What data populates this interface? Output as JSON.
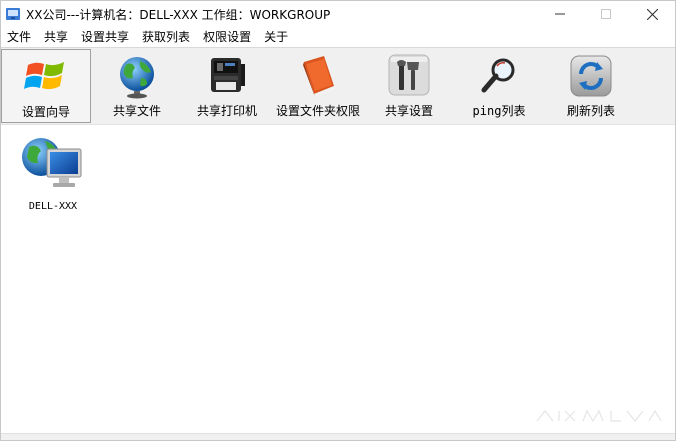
{
  "window": {
    "title": "XX公司---计算机名：DELL-XXX  工作组：WORKGROUP",
    "controls": [
      "minimize",
      "maximize",
      "close"
    ]
  },
  "menu": {
    "items": [
      "文件",
      "共享",
      "设置共享",
      "获取列表",
      "权限设置",
      "关于"
    ]
  },
  "toolbar": {
    "items": [
      {
        "label": "设置向导",
        "icon": "windows-logo-icon",
        "active": true
      },
      {
        "label": "共享文件",
        "icon": "globe-icon",
        "active": false
      },
      {
        "label": "共享打印机",
        "icon": "printer-icon",
        "active": false
      },
      {
        "label": "设置文件夹权限",
        "icon": "folder-book-icon",
        "active": false
      },
      {
        "label": "共享设置",
        "icon": "tools-icon",
        "active": false
      },
      {
        "label": "ping列表",
        "icon": "magnifier-icon",
        "active": false
      },
      {
        "label": "刷新列表",
        "icon": "refresh-icon",
        "active": false
      }
    ]
  },
  "content": {
    "computers": [
      {
        "name": "DELL-XXX",
        "icon": "network-computer-icon"
      }
    ]
  },
  "colors": {
    "toolbar_bg": "#f0f0f0",
    "content_bg": "#ffffff",
    "window_border": "#c8c8c8"
  }
}
